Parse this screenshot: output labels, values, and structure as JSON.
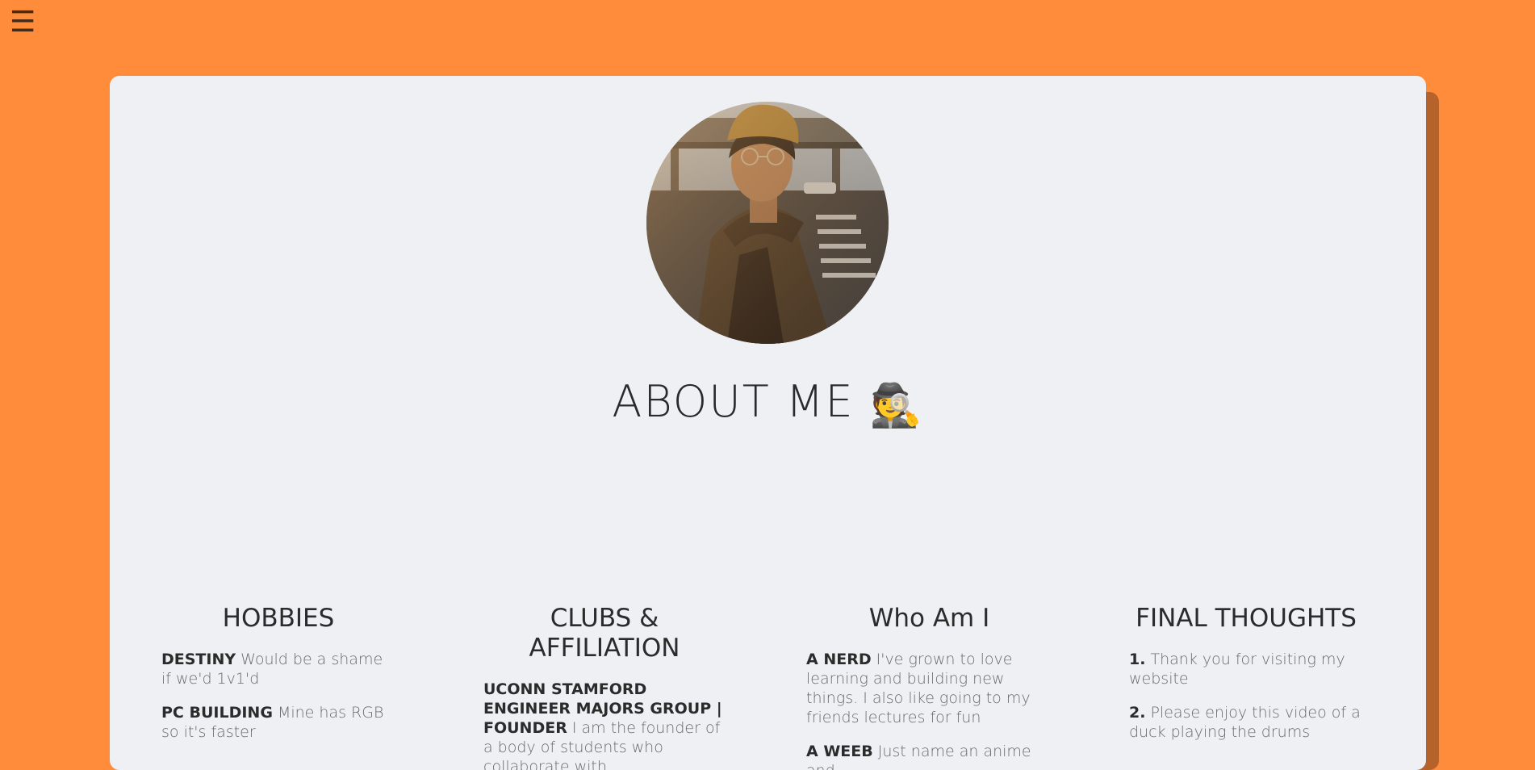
{
  "nav": {
    "menu_icon": "☰"
  },
  "profile": {
    "photo_alt": "profile photo",
    "title": "ABOUT ME",
    "title_emoji": "🕵️"
  },
  "sections": {
    "hobbies": {
      "heading": "HOBBIES",
      "items": [
        {
          "term": "DESTINY",
          "text": "Would be a shame if we'd 1v1'd"
        },
        {
          "term": "PC BUILDING",
          "text": "Mine has RGB so it's faster"
        }
      ]
    },
    "clubs": {
      "heading": "CLUBS & AFFILIATION",
      "items": [
        {
          "term": "UCONN STAMFORD ENGINEER MAJORS GROUP | FOUNDER",
          "text": "I am the founder of a body of students who collaborate with"
        }
      ]
    },
    "who": {
      "heading": "Who Am I",
      "items": [
        {
          "term": "A NERD",
          "text": "I've grown to love learning and building new things. I also like going to my friends lectures for fun"
        },
        {
          "term": "A WEEB",
          "text": "Just name an anime and"
        }
      ]
    },
    "final": {
      "heading": "FINAL THOUGHTS",
      "items": [
        {
          "term": "1.",
          "text": "Thank you for visiting my website"
        },
        {
          "term": "2.",
          "text": "Please enjoy this video of a duck playing the drums"
        }
      ]
    }
  },
  "colors": {
    "background": "#fe8c3a",
    "card": "#eff0f4",
    "card_shadow": "#b5622b",
    "text_dark": "#2b2b2b",
    "text_light": "#6a6a6a"
  }
}
